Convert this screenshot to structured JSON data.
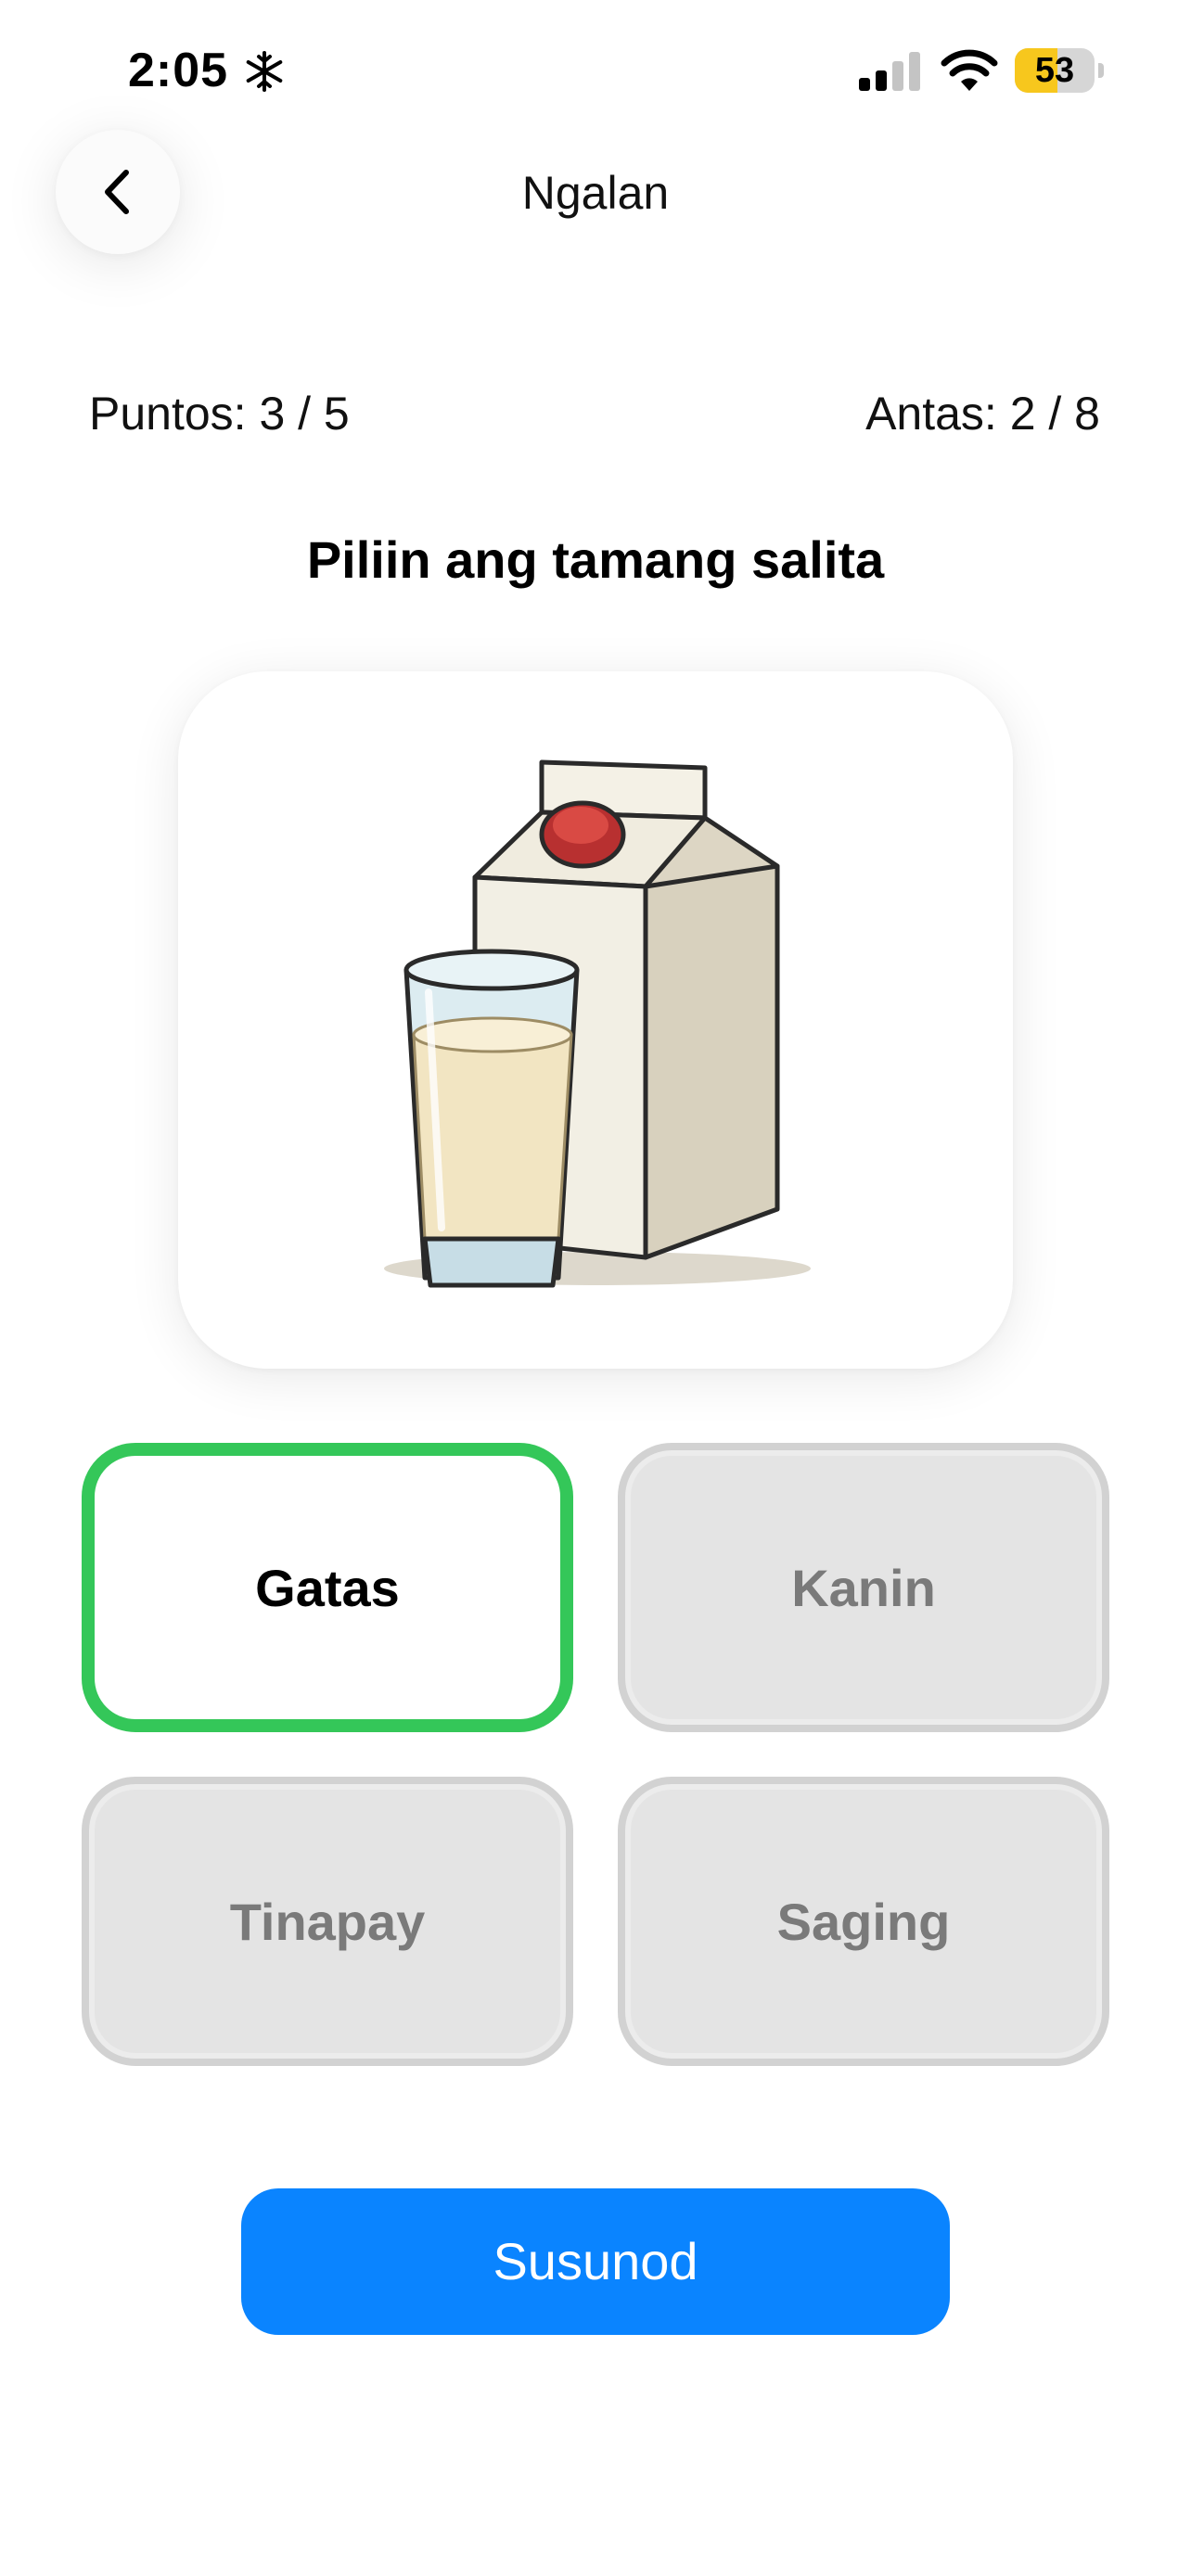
{
  "status_bar": {
    "time": "2:05",
    "battery_level": "53",
    "battery_fraction": 0.53,
    "icons": [
      "snowflake-icon",
      "signal-icon",
      "wifi-icon",
      "battery-icon"
    ]
  },
  "nav": {
    "back_icon": "chevron-left-icon",
    "title": "Ngalan"
  },
  "stats": {
    "score": "Puntos: 3 / 5",
    "level": "Antas: 2 / 8"
  },
  "prompt": "Piliin ang tamang salita",
  "picture": {
    "icon": "milk-carton-and-glass-illustration"
  },
  "options": [
    {
      "label": "Gatas",
      "state": "selected"
    },
    {
      "label": "Kanin",
      "state": "disabled"
    },
    {
      "label": "Tinapay",
      "state": "disabled"
    },
    {
      "label": "Saging",
      "state": "disabled"
    }
  ],
  "next_button": {
    "label": "Susunod"
  },
  "colors": {
    "selected_border": "#34c759",
    "primary_button": "#0a84ff",
    "disabled_fill": "#e4e4e4",
    "disabled_text": "#7a7a7a",
    "battery": "#f7c71d"
  }
}
